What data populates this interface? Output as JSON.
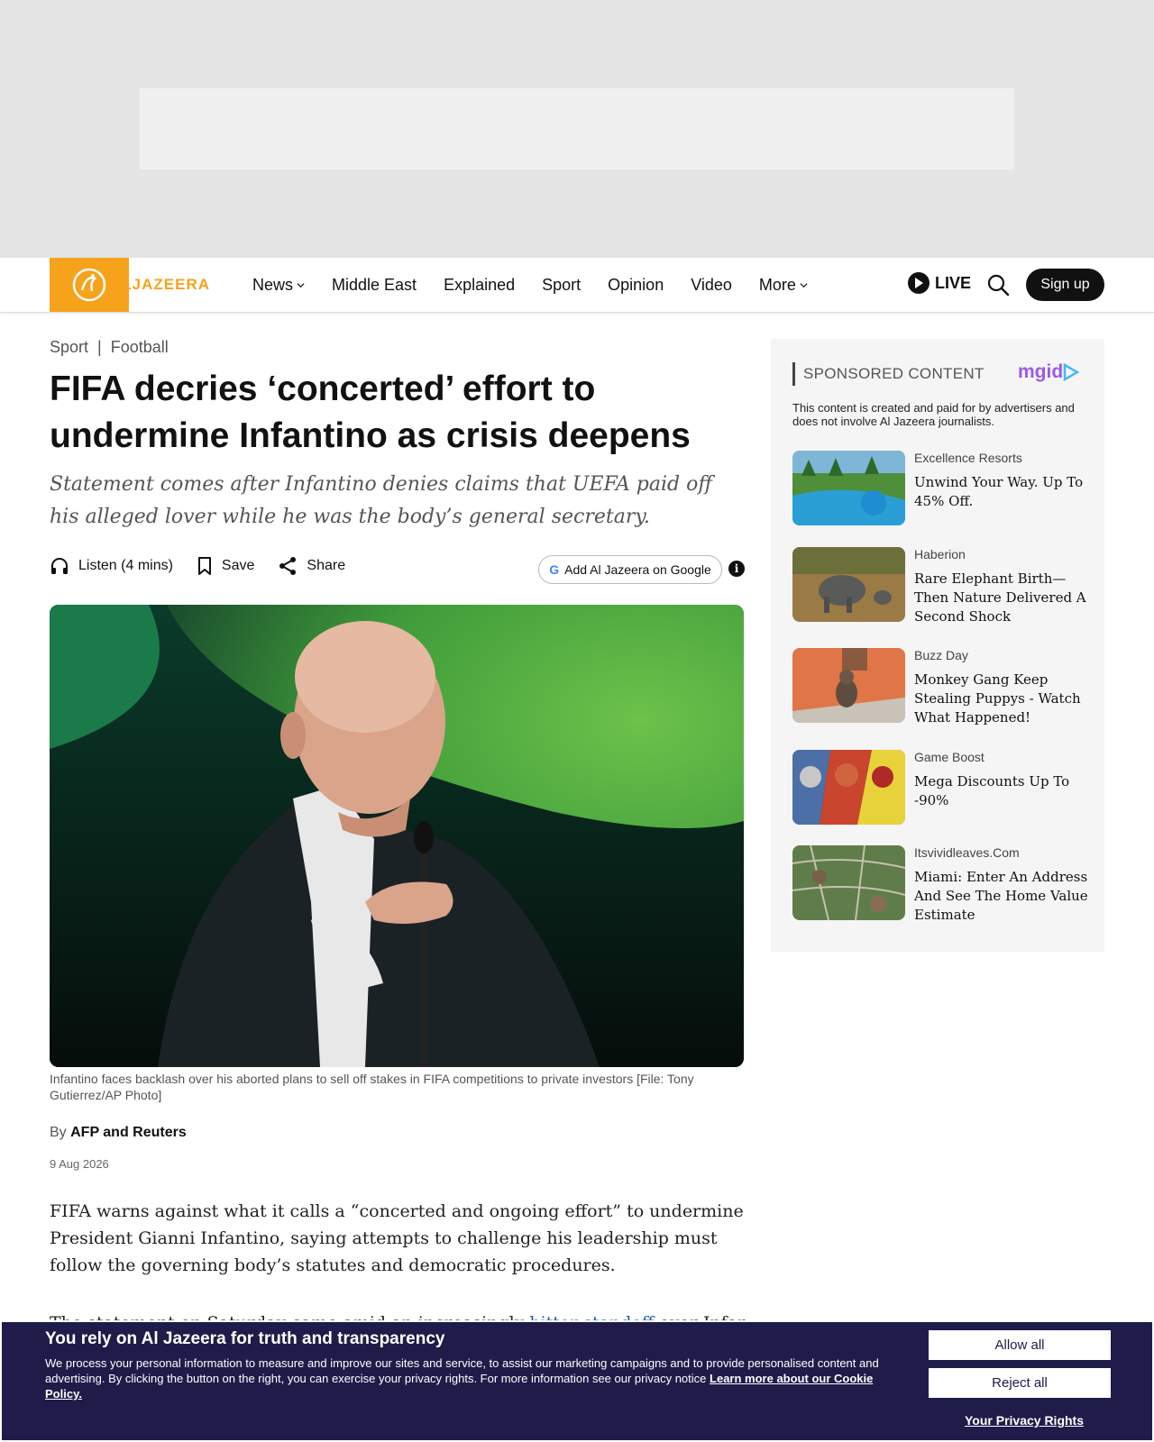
{
  "header": {
    "logo_text": "ALJAZEERA",
    "nav": [
      {
        "label": "News",
        "dropdown": true
      },
      {
        "label": "Middle East",
        "dropdown": false
      },
      {
        "label": "Explained",
        "dropdown": false
      },
      {
        "label": "Sport",
        "dropdown": false
      },
      {
        "label": "Opinion",
        "dropdown": false
      },
      {
        "label": "Video",
        "dropdown": false
      },
      {
        "label": "More",
        "dropdown": true
      }
    ],
    "live_label": "LIVE",
    "signup_label": "Sign up"
  },
  "article": {
    "breadcrumb": [
      "Sport",
      "Football"
    ],
    "breadcrumb_sep": "|",
    "headline": "FIFA decries ‘concerted’ effort to undermine Infantino as crisis deepens",
    "deck": "Statement comes after Infantino denies claims that UEFA paid off his alleged lover while he was the body’s general secretary.",
    "actions": {
      "listen": "Listen (4 mins)",
      "save": "Save",
      "share": "Share"
    },
    "google_button": "Add Al Jazeera on Google",
    "info_icon": "i",
    "caption": "Infantino faces backlash over his aborted plans to sell off stakes in FIFA competitions to private investors [File: Tony Gutierrez/AP Photo]",
    "byline_prefix": "By",
    "byline_author": "AFP and Reuters",
    "date": "9 Aug 2026",
    "paragraph1": "FIFA warns against what it calls a “concerted and ongoing effort” to undermine President Gianni Infantino, saying attempts to challenge his leadership must follow the governing body’s statutes and democratic procedures.",
    "paragraph2_start": "The statement on Saturday came amid an increasingly ",
    "paragraph2_link": "bitter standoff",
    "paragraph2_end": " over Infantino’s"
  },
  "sponsored": {
    "title": "SPONSORED CONTENT",
    "logo": "mgid",
    "note": "This content is created and paid for by advertisers and does not involve Al Jazeera journalists.",
    "items": [
      {
        "source": "Excellence Resorts",
        "text": "Unwind Your Way. Up To 45% Off."
      },
      {
        "source": "Haberion",
        "text": "Rare Elephant Birth—Then Nature Delivered A Second Shock"
      },
      {
        "source": "Buzz Day",
        "text": "Monkey Gang Keep Stealing Puppys - Watch What Happened!"
      },
      {
        "source": "Game Boost",
        "text": "Mega Discounts Up To -90%"
      },
      {
        "source": "Itsvividleaves.Com",
        "text": "Miami: Enter An Address And See The Home Value Estimate"
      }
    ]
  },
  "cookie": {
    "title": "You rely on Al Jazeera for truth and transparency",
    "text": "We process your personal information to measure and improve our sites and service, to assist our marketing campaigns and to provide personalised content and advertising. By clicking the button on the right, you can exercise your privacy rights. For more information see our privacy notice",
    "link": "Learn more about our Cookie Policy.",
    "allow": "Allow all",
    "reject": "Reject all",
    "privacy": "Your Privacy Rights"
  },
  "colors": {
    "brand": "#f7a21b",
    "cookie_bg": "#1f1c4a",
    "link": "#1a5fa0"
  }
}
